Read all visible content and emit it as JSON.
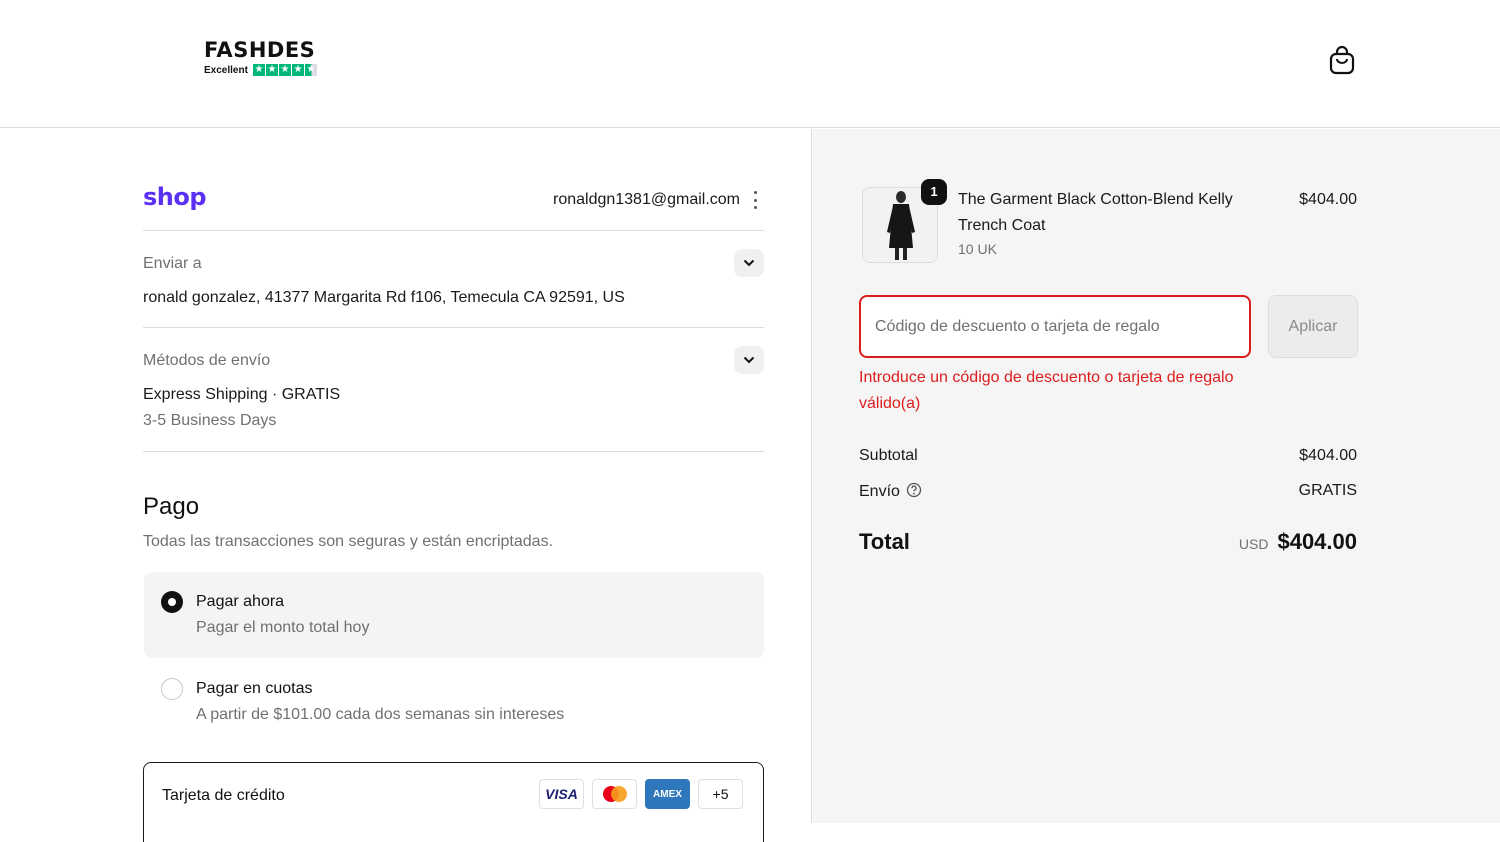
{
  "header": {
    "brand": "FASHDES",
    "rating_label": "Excellent",
    "star_color": "#00b67a",
    "cart_icon": "shopping-bag-icon"
  },
  "account": {
    "shop_logo": "shop",
    "email": "ronaldgn1381@gmail.com"
  },
  "shipping_address": {
    "label": "Enviar a",
    "value": "ronald gonzalez, 41377 Margarita Rd f106, Temecula CA 92591, US"
  },
  "shipping_method": {
    "label": "Métodos de envío",
    "name": "Express Shipping · ",
    "price": "GRATIS",
    "eta": "3-5 Business Days"
  },
  "payment": {
    "title": "Pago",
    "subtitle": "Todas las transacciones son seguras y están encriptadas.",
    "options": [
      {
        "title": "Pagar ahora",
        "subtitle": "Pagar el monto total hoy",
        "selected": true
      },
      {
        "title": "Pagar en cuotas",
        "subtitle": "A partir de $101.00 cada dos semanas sin intereses",
        "selected": false
      }
    ],
    "card": {
      "label": "Tarjeta de crédito",
      "logos": [
        "VISA",
        "mastercard",
        "AMEX",
        "+5"
      ]
    }
  },
  "order": {
    "item": {
      "quantity": "1",
      "name": "The Garment Black Cotton-Blend Kelly Trench Coat",
      "variant": "10 UK",
      "price": "$404.00"
    },
    "discount": {
      "placeholder": "Código de descuento o tarjeta de regalo",
      "value": "",
      "apply_label": "Aplicar",
      "error": "Introduce un código de descuento o tarjeta de regalo válido(a)",
      "error_color": "#dd1d1d"
    },
    "subtotal_label": "Subtotal",
    "subtotal_value": "$404.00",
    "shipping_label": "Envío",
    "shipping_value": "GRATIS",
    "total_label": "Total",
    "currency": "USD",
    "total_value": "$404.00"
  },
  "colors": {
    "shop_purple": "#5a31f4",
    "error_red": "#dd1d1d",
    "summary_bg": "#f5f5f5"
  }
}
